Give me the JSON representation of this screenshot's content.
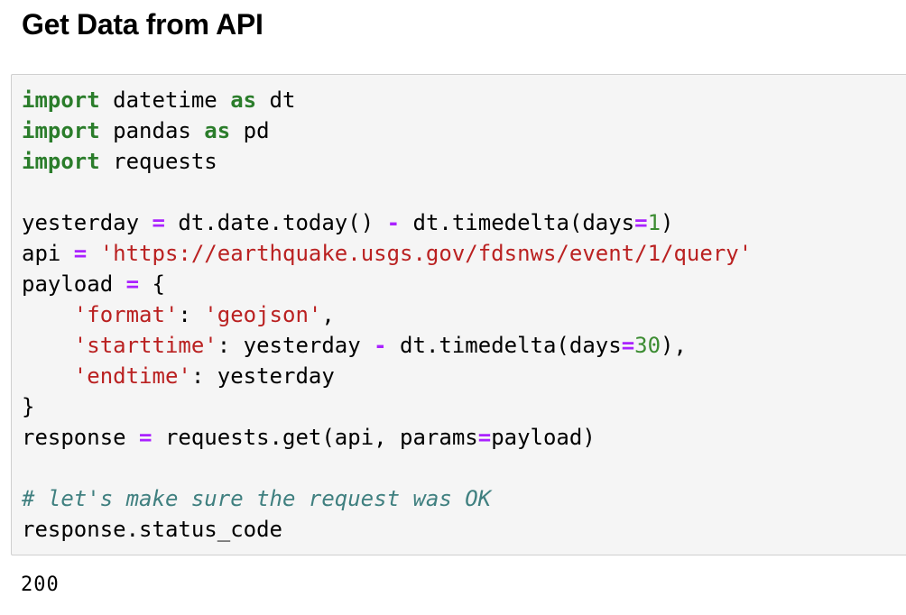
{
  "heading": "Get Data from API",
  "code": {
    "lines": [
      [
        {
          "t": "kw",
          "v": "import"
        },
        {
          "t": "",
          "v": " datetime "
        },
        {
          "t": "kw",
          "v": "as"
        },
        {
          "t": "",
          "v": " dt"
        }
      ],
      [
        {
          "t": "kw",
          "v": "import"
        },
        {
          "t": "",
          "v": " pandas "
        },
        {
          "t": "kw",
          "v": "as"
        },
        {
          "t": "",
          "v": " pd"
        }
      ],
      [
        {
          "t": "kw",
          "v": "import"
        },
        {
          "t": "",
          "v": " requests"
        }
      ],
      [],
      [
        {
          "t": "",
          "v": "yesterday "
        },
        {
          "t": "op",
          "v": "="
        },
        {
          "t": "",
          "v": " dt.date.today() "
        },
        {
          "t": "op",
          "v": "-"
        },
        {
          "t": "",
          "v": " dt.timedelta(days"
        },
        {
          "t": "op",
          "v": "="
        },
        {
          "t": "num",
          "v": "1"
        },
        {
          "t": "",
          "v": ")"
        }
      ],
      [
        {
          "t": "",
          "v": "api "
        },
        {
          "t": "op",
          "v": "="
        },
        {
          "t": "",
          "v": " "
        },
        {
          "t": "str",
          "v": "'https://earthquake.usgs.gov/fdsnws/event/1/query'"
        }
      ],
      [
        {
          "t": "",
          "v": "payload "
        },
        {
          "t": "op",
          "v": "="
        },
        {
          "t": "",
          "v": " {"
        }
      ],
      [
        {
          "t": "",
          "v": "    "
        },
        {
          "t": "str",
          "v": "'format'"
        },
        {
          "t": "",
          "v": ": "
        },
        {
          "t": "str",
          "v": "'geojson'"
        },
        {
          "t": "",
          "v": ","
        }
      ],
      [
        {
          "t": "",
          "v": "    "
        },
        {
          "t": "str",
          "v": "'starttime'"
        },
        {
          "t": "",
          "v": ": yesterday "
        },
        {
          "t": "op",
          "v": "-"
        },
        {
          "t": "",
          "v": " dt.timedelta(days"
        },
        {
          "t": "op",
          "v": "="
        },
        {
          "t": "num",
          "v": "30"
        },
        {
          "t": "",
          "v": "),"
        }
      ],
      [
        {
          "t": "",
          "v": "    "
        },
        {
          "t": "str",
          "v": "'endtime'"
        },
        {
          "t": "",
          "v": ": yesterday"
        }
      ],
      [
        {
          "t": "",
          "v": "}"
        }
      ],
      [
        {
          "t": "",
          "v": "response "
        },
        {
          "t": "op",
          "v": "="
        },
        {
          "t": "",
          "v": " requests.get(api, params"
        },
        {
          "t": "op",
          "v": "="
        },
        {
          "t": "",
          "v": "payload)"
        }
      ],
      [],
      [
        {
          "t": "cm",
          "v": "# let's make sure the request was OK"
        }
      ],
      [
        {
          "t": "",
          "v": "response.status_code"
        }
      ]
    ]
  },
  "output": {
    "value": "200"
  },
  "colors": {
    "keyword": "#2b7d2b",
    "operator": "#aa22ff",
    "string": "#ba2121",
    "number": "#3c8c32",
    "comment": "#408080",
    "cell_background": "#f5f5f5",
    "cell_border": "#cfcfcf"
  }
}
